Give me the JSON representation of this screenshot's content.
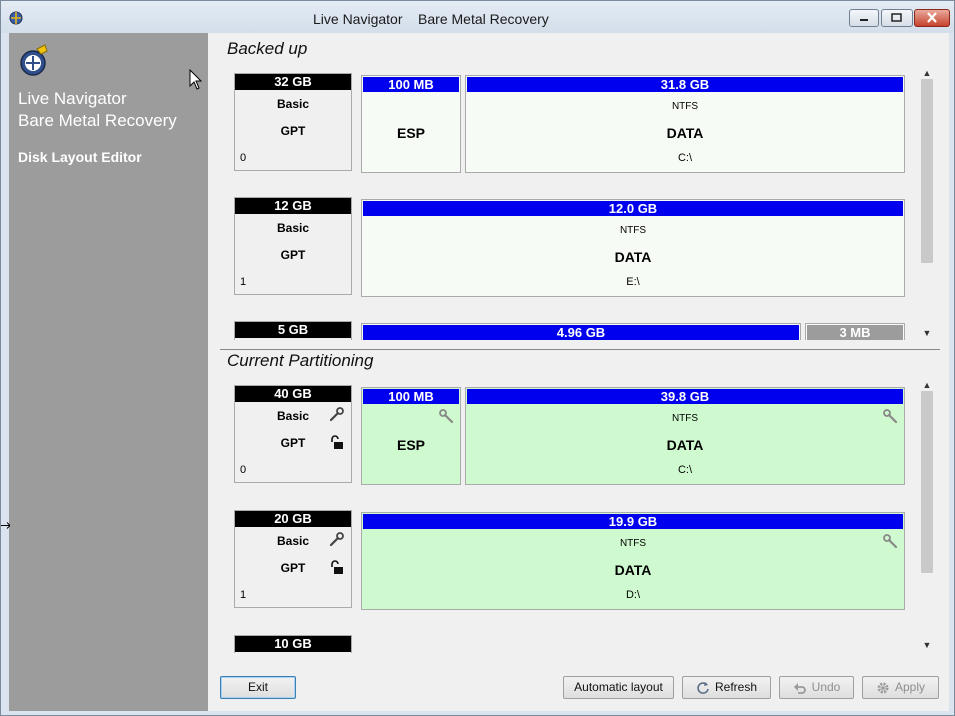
{
  "window": {
    "title": "Live Navigator    Bare Metal Recovery"
  },
  "sidebar": {
    "title_line1": "Live Navigator",
    "title_line2": "Bare Metal Recovery",
    "subtitle": "Disk Layout Editor"
  },
  "backed_up": {
    "title": "Backed up",
    "disks": [
      {
        "size": "32 GB",
        "type": "Basic",
        "style": "GPT",
        "number": "0",
        "partitions": [
          {
            "size": "100 MB",
            "fs": "",
            "label": "ESP",
            "drive": ""
          },
          {
            "size": "31.8 GB",
            "fs": "NTFS",
            "label": "DATA",
            "drive": "C:\\"
          }
        ]
      },
      {
        "size": "12 GB",
        "type": "Basic",
        "style": "GPT",
        "number": "1",
        "partitions": [
          {
            "size": "12.0 GB",
            "fs": "NTFS",
            "label": "DATA",
            "drive": "E:\\"
          }
        ]
      },
      {
        "size": "5 GB",
        "partitions": [
          {
            "size": "4.96 GB"
          },
          {
            "size": "3 MB"
          }
        ]
      }
    ]
  },
  "current": {
    "title": "Current Partitioning",
    "disks": [
      {
        "size": "40 GB",
        "type": "Basic",
        "style": "GPT",
        "number": "0",
        "partitions": [
          {
            "size": "100 MB",
            "fs": "",
            "label": "ESP",
            "drive": ""
          },
          {
            "size": "39.8 GB",
            "fs": "NTFS",
            "label": "DATA",
            "drive": "C:\\"
          }
        ]
      },
      {
        "size": "20 GB",
        "type": "Basic",
        "style": "GPT",
        "number": "1",
        "partitions": [
          {
            "size": "19.9 GB",
            "fs": "NTFS",
            "label": "DATA",
            "drive": "D:\\"
          }
        ]
      },
      {
        "size": "10 GB"
      }
    ]
  },
  "buttons": {
    "exit": "Exit",
    "automatic_layout": "Automatic layout",
    "refresh": "Refresh",
    "undo": "Undo",
    "apply": "Apply"
  },
  "colors": {
    "partition_header": "#0000ee",
    "unallocated_header": "#9c9c9c",
    "current_partition_bg": "#cff9cf",
    "backed_partition_bg": "#f7fbf5",
    "sidebar_bg": "#9c9c9c"
  },
  "icons": {
    "app": "globe-gear-icon",
    "tool": "wrench-icon",
    "lock": "unlocked-padlock-icon",
    "refresh": "refresh-icon",
    "undo": "undo-icon",
    "apply": "gear-icon"
  }
}
